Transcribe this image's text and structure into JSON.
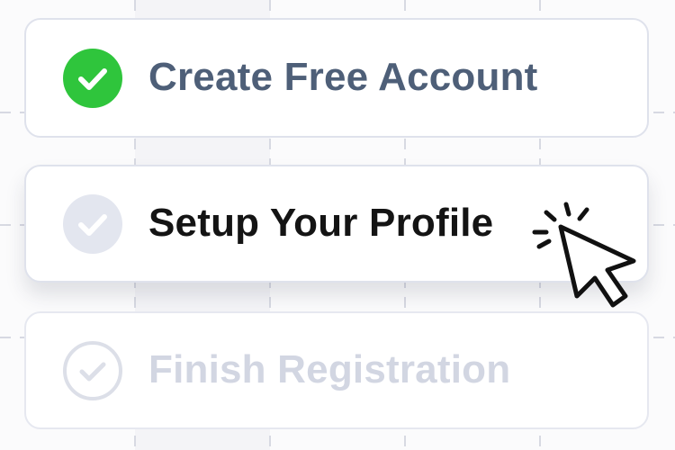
{
  "steps": [
    {
      "label": "Create Free Account",
      "state": "done",
      "icon": "check-circle-icon"
    },
    {
      "label": "Setup Your Profile",
      "state": "pending",
      "icon": "check-circle-icon"
    },
    {
      "label": "Finish Registration",
      "state": "upcoming",
      "icon": "check-circle-outline-icon"
    }
  ],
  "cursor": {
    "icon": "pointer-cursor-click-icon"
  },
  "colors": {
    "done_green": "#2fc53c",
    "done_text": "#4e5f78",
    "pending_text": "#141414",
    "upcoming_text": "#d2d6e2",
    "card_border": "#dfe2ec"
  }
}
